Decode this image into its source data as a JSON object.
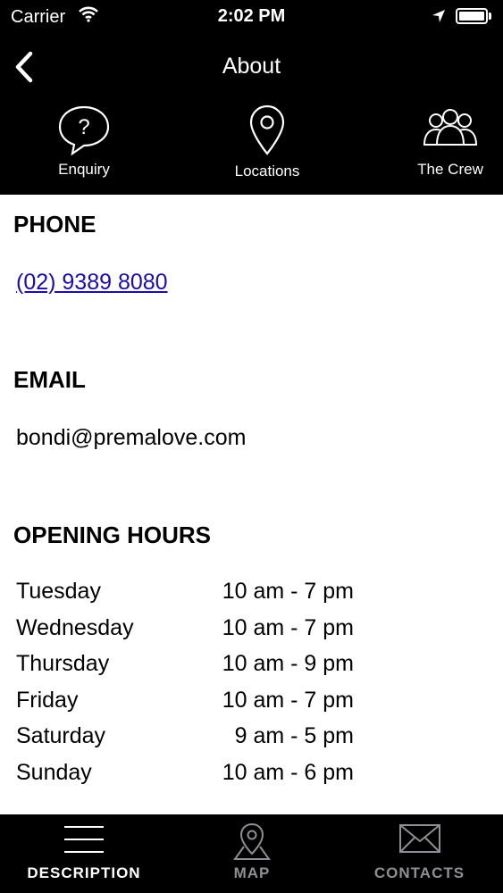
{
  "status_bar": {
    "carrier": "Carrier",
    "time": "2:02 PM"
  },
  "nav": {
    "title": "About",
    "back_icon": "chevron-left-icon"
  },
  "quick_actions": [
    {
      "label": "Enquiry",
      "icon": "question-bubble-icon"
    },
    {
      "label": "Locations",
      "icon": "location-pin-icon"
    },
    {
      "label": "The Crew",
      "icon": "people-group-icon"
    }
  ],
  "phone": {
    "heading": "PHONE",
    "value": "(02) 9389 8080"
  },
  "email": {
    "heading": "EMAIL",
    "value": "bondi@premalove.com"
  },
  "opening_hours": {
    "heading": "OPENING HOURS",
    "rows": [
      {
        "day": "Tuesday",
        "hours": "10 am - 7 pm"
      },
      {
        "day": "Wednesday",
        "hours": "10 am - 7 pm"
      },
      {
        "day": "Thursday",
        "hours": "10 am - 9 pm"
      },
      {
        "day": "Friday",
        "hours": "10 am - 7 pm"
      },
      {
        "day": "Saturday",
        "hours": "9 am - 5 pm"
      },
      {
        "day": "Sunday",
        "hours": "10 am - 6 pm"
      }
    ]
  },
  "tab_bar": [
    {
      "label": "DESCRIPTION",
      "icon": "menu-lines-icon",
      "active": true
    },
    {
      "label": "MAP",
      "icon": "map-pin-icon",
      "active": false
    },
    {
      "label": "CONTACTS",
      "icon": "envelope-icon",
      "active": false
    }
  ],
  "colors": {
    "bar_background": "#000000",
    "link": "#1a0dab",
    "tab_active": "#ffffff",
    "tab_inactive": "#8e8e93"
  }
}
